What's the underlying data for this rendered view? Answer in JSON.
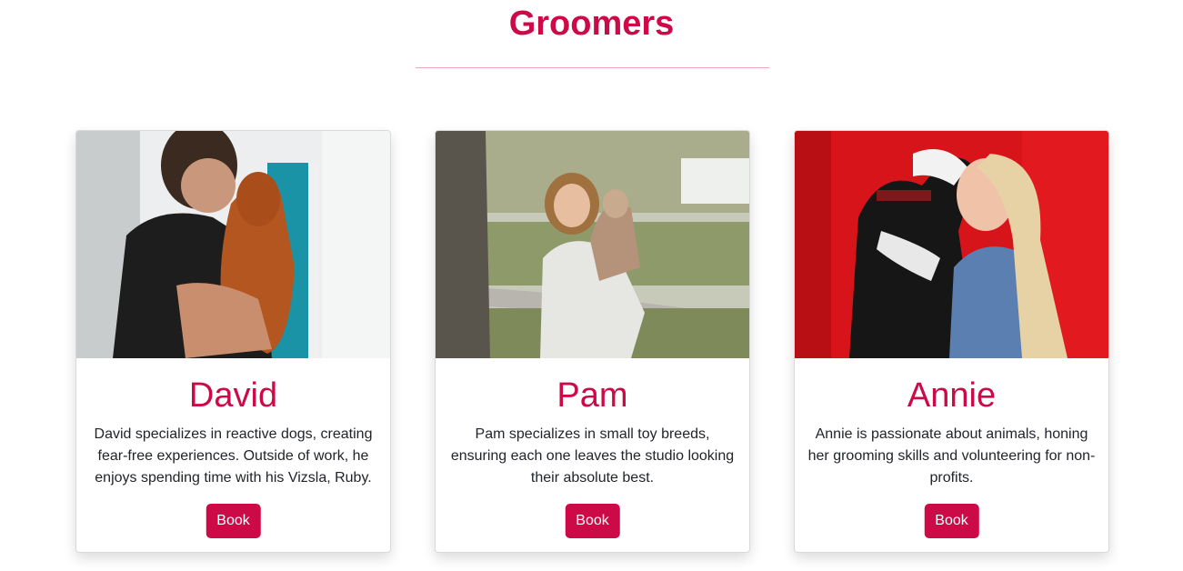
{
  "page": {
    "title": "Groomers"
  },
  "groomers": [
    {
      "name": "David",
      "description": "David specializes in reactive dogs, creating fear-free experiences. Outside of work, he enjoys spending time with his Vizsla, Ruby.",
      "button_label": "Book"
    },
    {
      "name": "Pam",
      "description": "Pam specializes in small toy breeds, ensuring each one leaves the studio looking their absolute best.",
      "button_label": "Book"
    },
    {
      "name": "Annie",
      "description": "Annie is passionate about animals, honing her grooming skills and volunteering for non-profits.",
      "button_label": "Book"
    }
  ],
  "colors": {
    "accent": "#cc0a47",
    "divider": "#f1a6bf",
    "text": "#212529"
  }
}
